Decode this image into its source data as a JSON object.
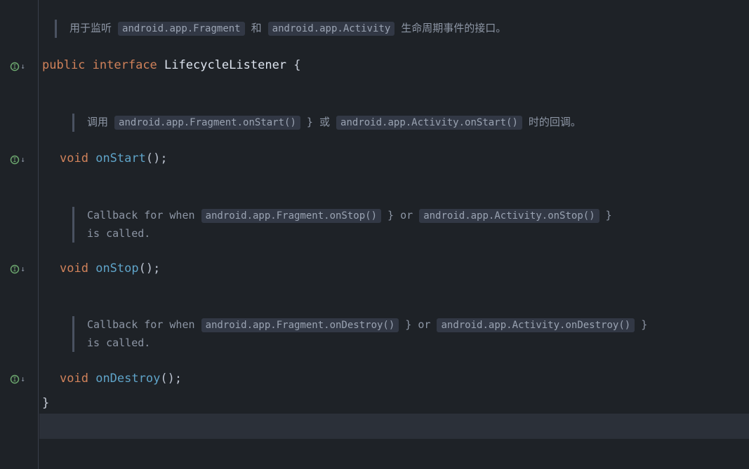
{
  "doc": {
    "interface": {
      "pre": "用于监听 ",
      "tag1": "android.app.Fragment",
      "mid": " 和 ",
      "tag2": "android.app.Activity",
      "post": " 生命周期事件的接口。"
    },
    "onStart": {
      "pre": "调用 ",
      "tag1": "android.app.Fragment.onStart()",
      "mid": " } 或 ",
      "tag2": "android.app.Activity.onStart()",
      "post": " 时的回调。"
    },
    "onStop": {
      "pre": "Callback for when ",
      "tag1": "android.app.Fragment.onStop()",
      "mid": " } or ",
      "tag2": "android.app.Activity.onStop()",
      "post": " } is called."
    },
    "onDestroy": {
      "pre": "Callback for when ",
      "tag1": "android.app.Fragment.onDestroy()",
      "mid": " } or ",
      "tag2": "android.app.Activity.onDestroy()",
      "post": " } is called."
    }
  },
  "code": {
    "kw_public": "public",
    "kw_interface": "interface",
    "type_name": "LifecycleListener",
    "open_brace": "{",
    "kw_void": "void",
    "m_onStart": "onStart",
    "m_onStop": "onStop",
    "m_onDestroy": "onDestroy",
    "parens": "()",
    "semi": ";",
    "close_brace": "}"
  }
}
